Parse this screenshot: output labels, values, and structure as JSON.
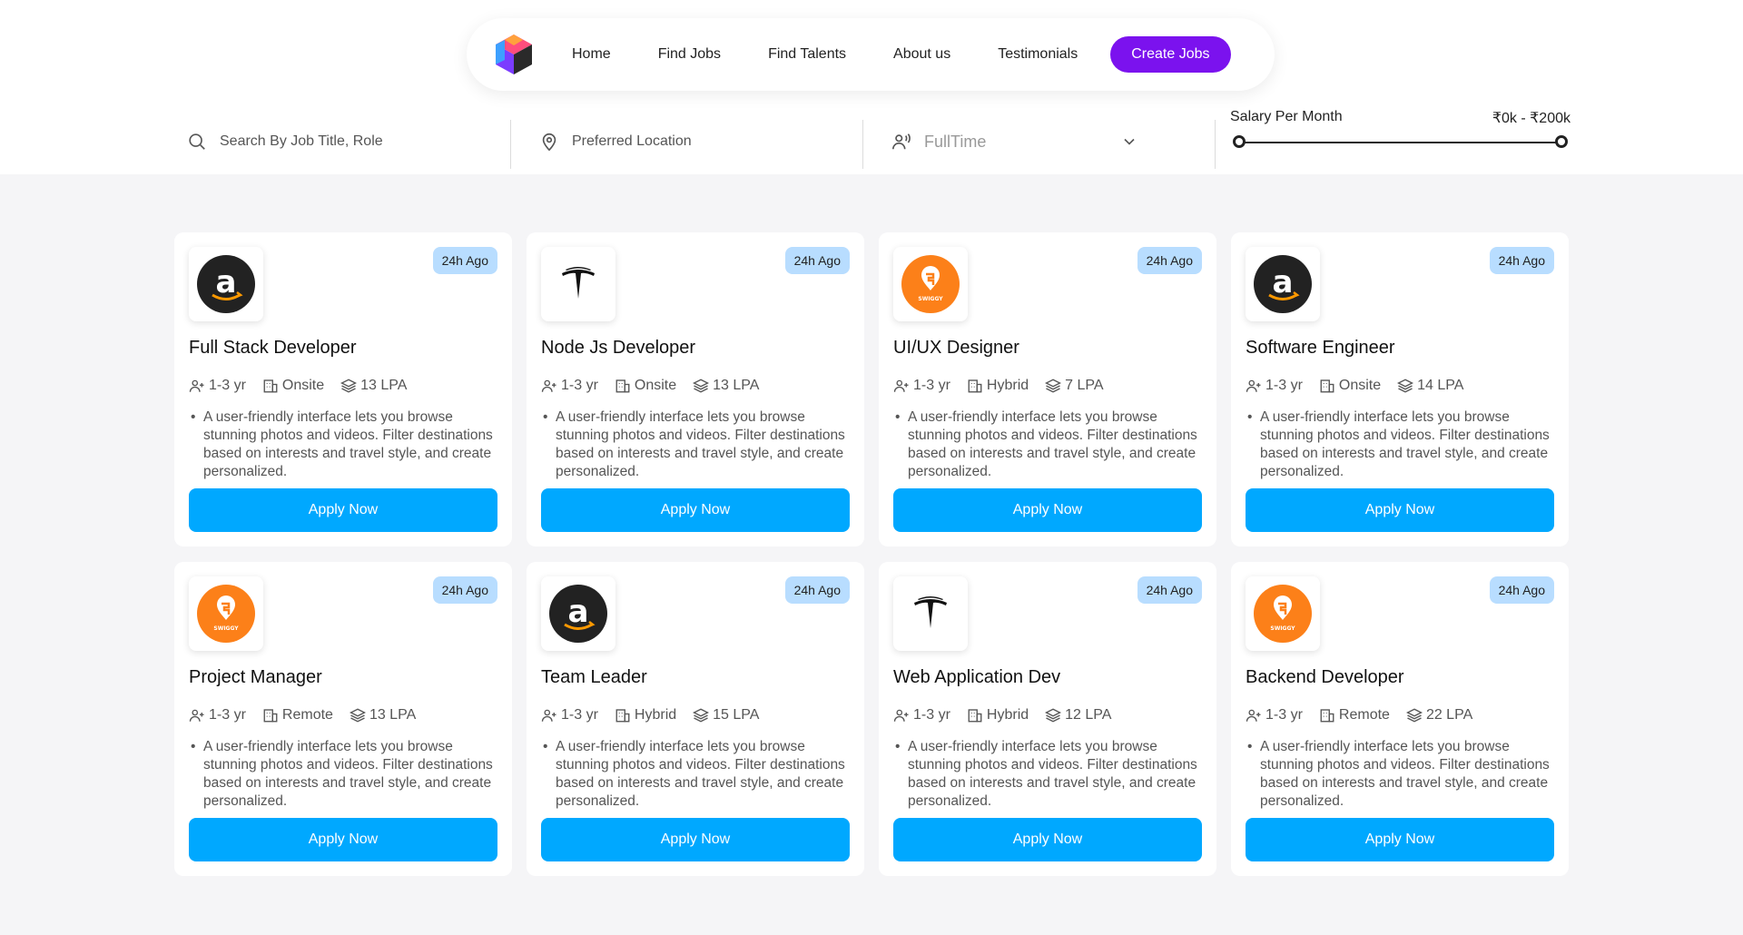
{
  "nav": {
    "logo_icon": "cube-logo-icon",
    "links": [
      "Home",
      "Find Jobs",
      "Find Talents",
      "About us",
      "Testimonials"
    ],
    "cta": "Create Jobs",
    "cta_color": "#7b12ee"
  },
  "search": {
    "keyword_placeholder": "Search By Job Title, Role",
    "location_placeholder": "Preferred Location",
    "job_type": "FullTime",
    "salary_label": "Salary Per Month",
    "salary_range": "₹0k - ₹200k",
    "salary_min_fraction": 0,
    "salary_max_fraction": 1
  },
  "apply_color": "#00a8ff",
  "badge_color": "#b8ddff",
  "jobs": [
    {
      "company": "amazon",
      "posted": "24h Ago",
      "title": "Full Stack Developer",
      "experience": "1-3 yr",
      "mode": "Onsite",
      "salary": "13 LPA",
      "description": "A user-friendly interface lets you browse stunning photos and videos. Filter destinations based on interests and travel style, and create personalized.",
      "button": "Apply Now"
    },
    {
      "company": "tesla",
      "posted": "24h Ago",
      "title": "Node Js Developer",
      "experience": "1-3 yr",
      "mode": "Onsite",
      "salary": "13 LPA",
      "description": "A user-friendly interface lets you browse stunning photos and videos. Filter destinations based on interests and travel style, and create personalized.",
      "button": "Apply Now"
    },
    {
      "company": "swiggy",
      "posted": "24h Ago",
      "title": "UI/UX Designer",
      "experience": "1-3 yr",
      "mode": "Hybrid",
      "salary": "7 LPA",
      "description": "A user-friendly interface lets you browse stunning photos and videos. Filter destinations based on interests and travel style, and create personalized.",
      "button": "Apply Now"
    },
    {
      "company": "amazon",
      "posted": "24h Ago",
      "title": "Software Engineer",
      "experience": "1-3 yr",
      "mode": "Onsite",
      "salary": "14 LPA",
      "description": "A user-friendly interface lets you browse stunning photos and videos. Filter destinations based on interests and travel style, and create personalized.",
      "button": "Apply Now"
    },
    {
      "company": "swiggy",
      "posted": "24h Ago",
      "title": "Project Manager",
      "experience": "1-3 yr",
      "mode": "Remote",
      "salary": "13 LPA",
      "description": "A user-friendly interface lets you browse stunning photos and videos. Filter destinations based on interests and travel style, and create personalized.",
      "button": "Apply Now"
    },
    {
      "company": "amazon",
      "posted": "24h Ago",
      "title": "Team Leader",
      "experience": "1-3 yr",
      "mode": "Hybrid",
      "salary": "15 LPA",
      "description": "A user-friendly interface lets you browse stunning photos and videos. Filter destinations based on interests and travel style, and create personalized.",
      "button": "Apply Now"
    },
    {
      "company": "tesla",
      "posted": "24h Ago",
      "title": "Web Application Dev",
      "experience": "1-3 yr",
      "mode": "Hybrid",
      "salary": "12 LPA",
      "description": "A user-friendly interface lets you browse stunning photos and videos. Filter destinations based on interests and travel style, and create personalized.",
      "button": "Apply Now"
    },
    {
      "company": "swiggy",
      "posted": "24h Ago",
      "title": "Backend Developer",
      "experience": "1-3 yr",
      "mode": "Remote",
      "salary": "22 LPA",
      "description": "A user-friendly interface lets you browse stunning photos and videos. Filter destinations based on interests and travel style, and create personalized.",
      "button": "Apply Now"
    }
  ],
  "swiggy_logo_text": "SWIGGY"
}
